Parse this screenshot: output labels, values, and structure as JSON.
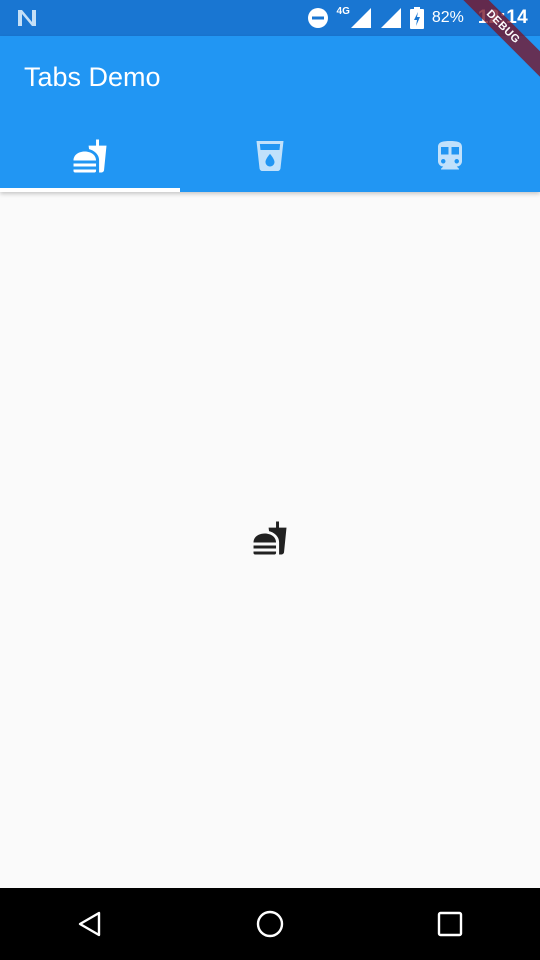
{
  "status_bar": {
    "network": "4G",
    "battery": "82%",
    "time": "12:14"
  },
  "debug_banner": "DEBUG",
  "app_bar": {
    "title": "Tabs Demo",
    "color": "#2196f3",
    "status_color": "#1976d2"
  },
  "tabs": [
    {
      "icon": "fastfood-icon",
      "selected": true
    },
    {
      "icon": "local-drink-icon",
      "selected": false
    },
    {
      "icon": "directions-subway-icon",
      "selected": false
    }
  ],
  "content": {
    "icon": "fastfood-icon"
  },
  "nav_bar": {
    "buttons": [
      "back-icon",
      "home-icon",
      "recents-icon"
    ]
  }
}
